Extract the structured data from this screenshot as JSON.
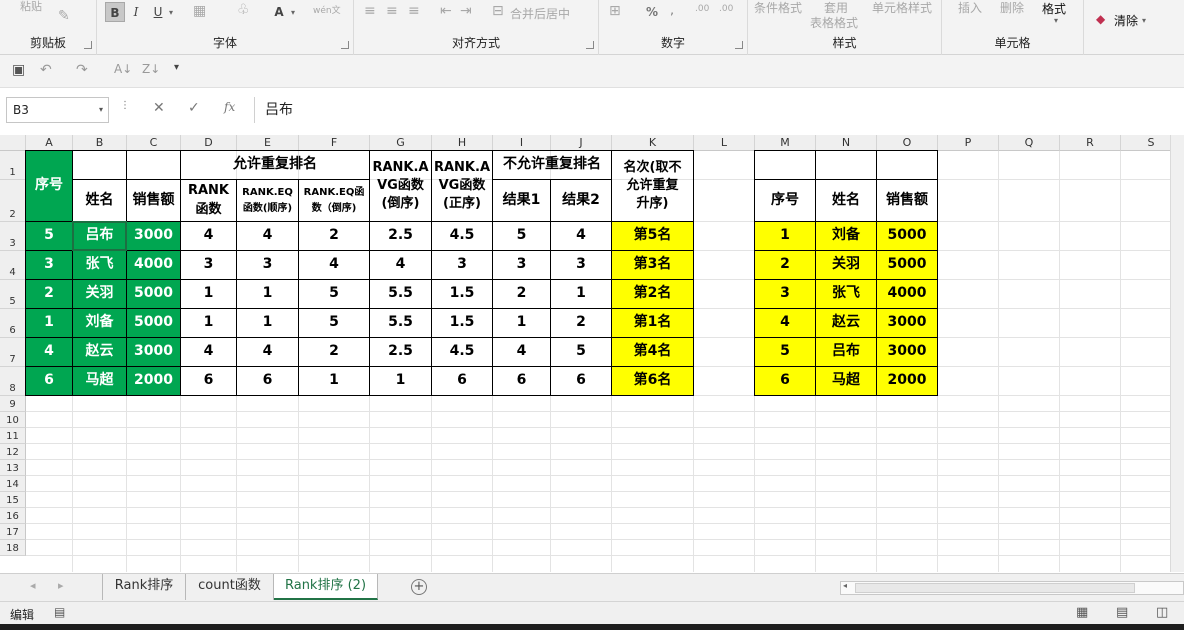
{
  "ribbon": {
    "paste_label": "粘贴",
    "groups": {
      "clipboard": "剪贴板",
      "font": "字体",
      "alignment": "对齐方式",
      "number": "数字",
      "styles": "样式",
      "cells": "单元格"
    },
    "font_buttons": {
      "bold": "B",
      "italic": "I",
      "underline": "U",
      "font_color": "A",
      "phonetic": "wén文"
    },
    "merge_center": "合并后居中",
    "percent": "%",
    "comma": ",",
    "conditional_format": "条件格式",
    "table_format_1": "套用",
    "table_format_2": "表格格式",
    "cell_styles": "单元格样式",
    "insert": "插入",
    "delete": "删除",
    "format": "格式",
    "clear": "清除"
  },
  "formula_bar": {
    "name_box": "B3",
    "cancel_icon": "✕",
    "enter_icon": "✓",
    "fx_label": "fx",
    "content": "吕布"
  },
  "grid": {
    "columns": [
      "A",
      "B",
      "C",
      "D",
      "E",
      "F",
      "G",
      "H",
      "I",
      "J",
      "K",
      "L",
      "M",
      "N",
      "O",
      "P",
      "Q",
      "R",
      "S"
    ],
    "rows": [
      "1",
      "2",
      "3",
      "4",
      "5",
      "6",
      "7",
      "8",
      "9",
      "10",
      "11",
      "12",
      "13",
      "14",
      "15",
      "16",
      "17",
      "18"
    ],
    "headers": {
      "seq": "序号",
      "name": "姓名",
      "sales": "销售额",
      "allow_dup": "允许重复排名",
      "rank_fn": "RANK\n函数",
      "rank_eq_asc": "RANK.EQ\n函数(顺序)",
      "rank_eq_desc": "RANK.EQ函\n数（倒序)",
      "rank_avg_desc": "RANK.A\nVG函数\n(倒序)",
      "rank_avg_asc": "RANK.A\nVG函数\n(正序)",
      "no_dup": "不允许重复排名",
      "result1": "结果1",
      "result2": "结果2",
      "rank_text": "名次(取不\n允许重复\n升序)",
      "seq2": "序号",
      "name2": "姓名",
      "sales2": "销售额"
    },
    "main_rows": [
      [
        "5",
        "吕布",
        "3000",
        "4",
        "4",
        "2",
        "2.5",
        "4.5",
        "5",
        "4",
        "第5名"
      ],
      [
        "3",
        "张飞",
        "4000",
        "3",
        "3",
        "4",
        "4",
        "3",
        "3",
        "3",
        "第3名"
      ],
      [
        "2",
        "关羽",
        "5000",
        "1",
        "1",
        "5",
        "5.5",
        "1.5",
        "2",
        "1",
        "第2名"
      ],
      [
        "1",
        "刘备",
        "5000",
        "1",
        "1",
        "5",
        "5.5",
        "1.5",
        "1",
        "2",
        "第1名"
      ],
      [
        "4",
        "赵云",
        "3000",
        "4",
        "4",
        "2",
        "2.5",
        "4.5",
        "4",
        "5",
        "第4名"
      ],
      [
        "6",
        "马超",
        "2000",
        "6",
        "6",
        "1",
        "1",
        "6",
        "6",
        "6",
        "第6名"
      ]
    ],
    "sorted_rows": [
      [
        "1",
        "刘备",
        "5000"
      ],
      [
        "2",
        "关羽",
        "5000"
      ],
      [
        "3",
        "张飞",
        "4000"
      ],
      [
        "4",
        "赵云",
        "3000"
      ],
      [
        "5",
        "吕布",
        "3000"
      ],
      [
        "6",
        "马超",
        "2000"
      ]
    ]
  },
  "sheet_tabs": [
    {
      "label": "Rank排序",
      "active": false
    },
    {
      "label": "count函数",
      "active": false
    },
    {
      "label": "Rank排序 (2)",
      "active": true
    }
  ],
  "status": {
    "mode": "编辑"
  },
  "colors": {
    "green_fill": "#00a651",
    "yellow_fill": "#ffff00",
    "excel_green": "#217346"
  }
}
